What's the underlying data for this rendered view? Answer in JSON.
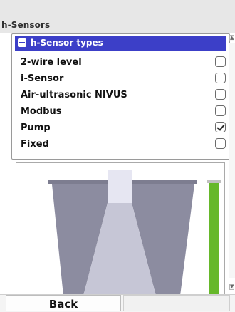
{
  "window": {
    "title": "h-Sensors"
  },
  "group": {
    "label": "h-Sensor types",
    "expanded": true
  },
  "items": [
    {
      "label": "2-wire level",
      "checked": false
    },
    {
      "label": "i-Sensor",
      "checked": false
    },
    {
      "label": "Air-ultrasonic NIVUS",
      "checked": false
    },
    {
      "label": "Modbus",
      "checked": false
    },
    {
      "label": "Pump",
      "checked": true
    },
    {
      "label": "Fixed",
      "checked": false
    }
  ],
  "footer": {
    "back_label": "Back"
  },
  "colors": {
    "header_bg": "#3c3fc8",
    "level_bar": "#66b82a",
    "tank_wall": "#8c8ca0"
  },
  "icons": {
    "collapse": "minus-icon",
    "checked": "check-icon"
  }
}
